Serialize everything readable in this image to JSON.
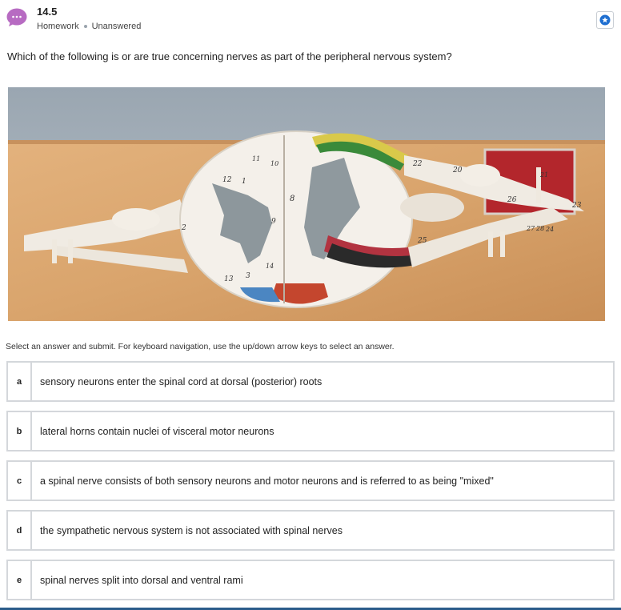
{
  "header": {
    "question_number": "14.5",
    "type": "Homework",
    "status": "Unanswered",
    "accent_color": "#b76bc2",
    "icons": [
      "chat-bubble-icon",
      "bookmark-star-icon"
    ]
  },
  "question_text": "Which of the following is or are true concerning nerves as part of the peripheral nervous system?",
  "figure": {
    "labels": [
      "1",
      "2",
      "3",
      "8",
      "9",
      "10",
      "11",
      "12",
      "13",
      "14",
      "20",
      "21",
      "22",
      "23",
      "24",
      "25",
      "26",
      "27",
      "28"
    ]
  },
  "instructions": "Select an answer and submit. For keyboard navigation, use the up/down arrow keys to select an answer.",
  "options": [
    {
      "letter": "a",
      "text": "sensory neurons enter the spinal cord at dorsal (posterior) roots"
    },
    {
      "letter": "b",
      "text": "lateral horns contain nuclei of visceral motor neurons"
    },
    {
      "letter": "c",
      "text": "a spinal nerve consists of both sensory neurons and motor neurons and is referred to as being \"mixed\""
    },
    {
      "letter": "d",
      "text": "the sympathetic nervous system is not associated with spinal nerves"
    },
    {
      "letter": "e",
      "text": "spinal nerves split into dorsal and ventral rami"
    }
  ]
}
